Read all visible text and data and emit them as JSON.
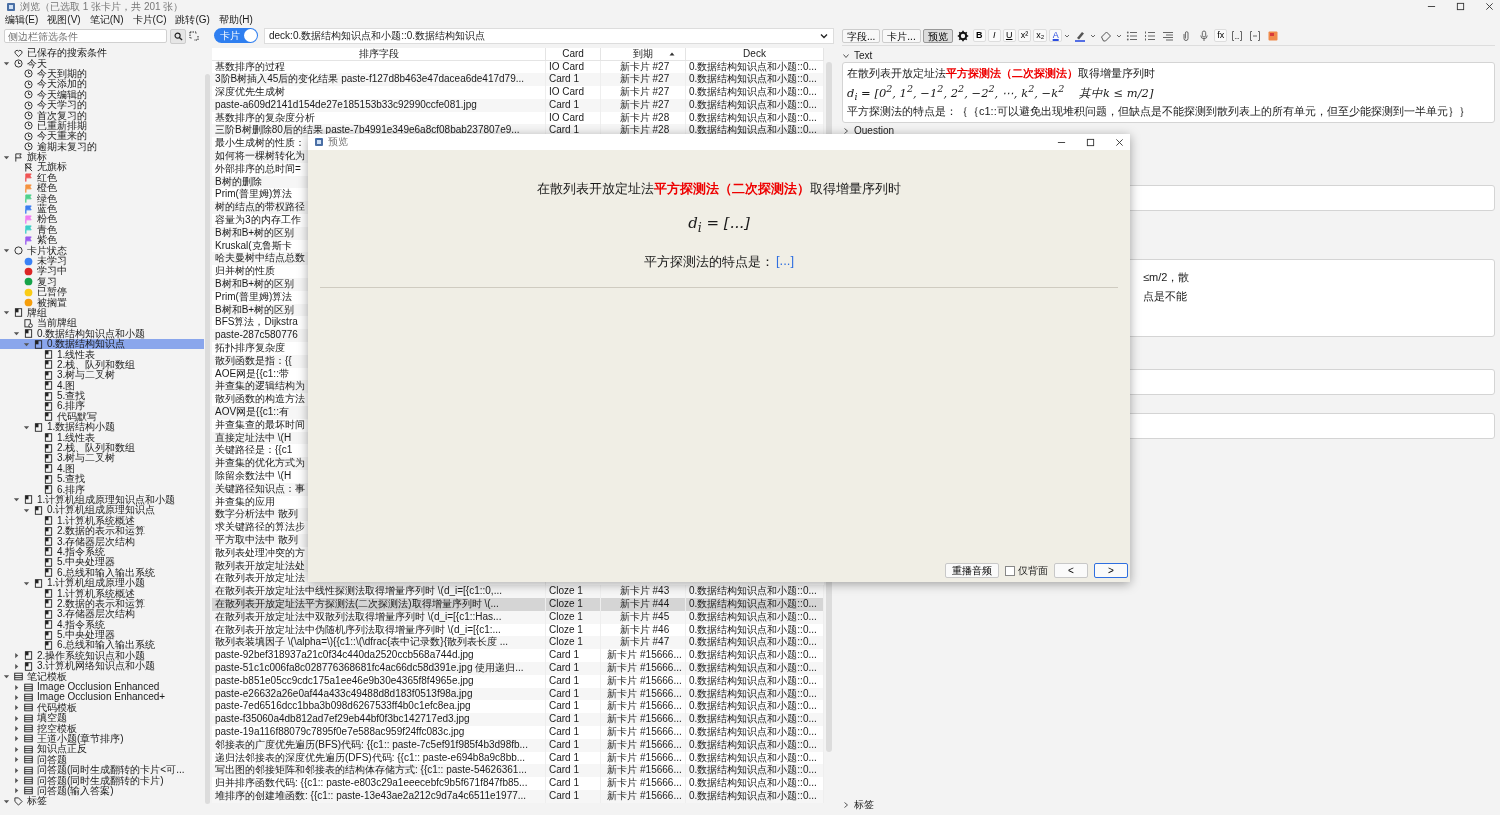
{
  "window": {
    "title": "浏览（已选取 1 张卡片，共 201 张）"
  },
  "menu": [
    "编辑(E)",
    "视图(V)",
    "笔记(N)",
    "卡片(C)",
    "跳转(G)",
    "帮助(H)"
  ],
  "sidebar": {
    "search": {
      "placeholder": "侧边栏筛选条件"
    },
    "tree": [
      {
        "label": "已保存的搜索条件",
        "kind": "heart",
        "selected": false
      },
      {
        "label": "今天",
        "kind": "clock",
        "selected": false,
        "expanded": true,
        "children": [
          {
            "label": "今天到期的",
            "kind": "clock",
            "selected": false
          },
          {
            "label": "今天添加的",
            "kind": "clock",
            "selected": false
          },
          {
            "label": "今天编辑的",
            "kind": "clock",
            "selected": false
          },
          {
            "label": "今天学习的",
            "kind": "clock",
            "selected": false
          },
          {
            "label": "首次复习的",
            "kind": "clock",
            "selected": false
          },
          {
            "label": "已重新排期",
            "kind": "clock",
            "selected": false
          },
          {
            "label": "今天重来的",
            "kind": "clock",
            "selected": false
          },
          {
            "label": "逾期未复习的",
            "kind": "clock",
            "selected": false
          }
        ]
      },
      {
        "label": "旗标",
        "kind": "flag-outline",
        "selected": false,
        "expanded": true,
        "children": [
          {
            "label": "无旗标",
            "kind": "flag-off",
            "selected": false
          },
          {
            "label": "红色",
            "kind": "flag",
            "color": "#f05454",
            "selected": false
          },
          {
            "label": "橙色",
            "kind": "flag",
            "color": "#f5923e",
            "selected": false
          },
          {
            "label": "绿色",
            "kind": "flag",
            "color": "#4fd18b",
            "selected": false
          },
          {
            "label": "蓝色",
            "kind": "flag",
            "color": "#3b7ef0",
            "selected": false
          },
          {
            "label": "粉色",
            "kind": "flag",
            "color": "#f07cf0",
            "selected": false
          },
          {
            "label": "青色",
            "kind": "flag",
            "color": "#3cd0c8",
            "selected": false
          },
          {
            "label": "紫色",
            "kind": "flag",
            "color": "#9b5cf0",
            "selected": false
          }
        ]
      },
      {
        "label": "卡片状态",
        "kind": "circle",
        "selected": false,
        "expanded": true,
        "children": [
          {
            "label": "未学习",
            "kind": "dot",
            "color": "#3b82f6",
            "selected": false
          },
          {
            "label": "学习中",
            "kind": "dot",
            "color": "#dc2626",
            "selected": false
          },
          {
            "label": "复习",
            "kind": "dot",
            "color": "#16a34a",
            "selected": false
          },
          {
            "label": "已暂停",
            "kind": "dot",
            "color": "#facc15",
            "selected": false
          },
          {
            "label": "被搁置",
            "kind": "dot",
            "color": "#f59e0b",
            "selected": false
          }
        ]
      },
      {
        "label": "牌组",
        "kind": "deck",
        "selected": false,
        "expanded": true,
        "children": [
          {
            "label": "当前牌组",
            "kind": "current-deck",
            "selected": false
          },
          {
            "label": "0.数据结构知识点和小题",
            "kind": "deck",
            "selected": false,
            "expanded": true,
            "children": [
              {
                "label": "0.数据结构知识点",
                "kind": "deck",
                "selected": true,
                "expanded": true,
                "children": [
                  {
                    "label": "1.线性表",
                    "kind": "deck",
                    "selected": false
                  },
                  {
                    "label": "2.栈、队列和数组",
                    "kind": "deck",
                    "selected": false
                  },
                  {
                    "label": "3.树与二叉树",
                    "kind": "deck",
                    "selected": false
                  },
                  {
                    "label": "4.图",
                    "kind": "deck",
                    "selected": false
                  },
                  {
                    "label": "5.查找",
                    "kind": "deck",
                    "selected": false
                  },
                  {
                    "label": "6.排序",
                    "kind": "deck",
                    "selected": false
                  },
                  {
                    "label": "代码默写",
                    "kind": "deck",
                    "selected": false
                  }
                ]
              },
              {
                "label": "1.数据结构小题",
                "kind": "deck",
                "selected": false,
                "expanded": true,
                "children": [
                  {
                    "label": "1.线性表",
                    "kind": "deck",
                    "selected": false
                  },
                  {
                    "label": "2.栈、队列和数组",
                    "kind": "deck",
                    "selected": false
                  },
                  {
                    "label": "3.树与二叉树",
                    "kind": "deck",
                    "selected": false
                  },
                  {
                    "label": "4.图",
                    "kind": "deck",
                    "selected": false
                  },
                  {
                    "label": "5.查找",
                    "kind": "deck",
                    "selected": false
                  },
                  {
                    "label": "6.排序",
                    "kind": "deck",
                    "selected": false
                  }
                ]
              }
            ]
          },
          {
            "label": "1.计算机组成原理知识点和小题",
            "kind": "deck",
            "selected": false,
            "expanded": true,
            "children": [
              {
                "label": "0.计算机组成原理知识点",
                "kind": "deck",
                "selected": false,
                "expanded": true,
                "children": [
                  {
                    "label": "1.计算机系统概述",
                    "kind": "deck",
                    "selected": false
                  },
                  {
                    "label": "2.数据的表示和运算",
                    "kind": "deck",
                    "selected": false
                  },
                  {
                    "label": "3.存储器层次结构",
                    "kind": "deck",
                    "selected": false
                  },
                  {
                    "label": "4.指令系统",
                    "kind": "deck",
                    "selected": false
                  },
                  {
                    "label": "5.中央处理器",
                    "kind": "deck",
                    "selected": false
                  },
                  {
                    "label": "6.总线和输入输出系统",
                    "kind": "deck",
                    "selected": false
                  }
                ]
              },
              {
                "label": "1.计算机组成原理小题",
                "kind": "deck",
                "selected": false,
                "expanded": true,
                "children": [
                  {
                    "label": "1.计算机系统概述",
                    "kind": "deck",
                    "selected": false
                  },
                  {
                    "label": "2.数据的表示和运算",
                    "kind": "deck",
                    "selected": false
                  },
                  {
                    "label": "3.存储器层次结构",
                    "kind": "deck",
                    "selected": false
                  },
                  {
                    "label": "4.指令系统",
                    "kind": "deck",
                    "selected": false
                  },
                  {
                    "label": "5.中央处理器",
                    "kind": "deck",
                    "selected": false
                  },
                  {
                    "label": "6.总线和输入输出系统",
                    "kind": "deck",
                    "selected": false
                  }
                ]
              }
            ]
          },
          {
            "label": "2.操作系统知识点和小题",
            "kind": "deck",
            "selected": false,
            "expanded": false
          },
          {
            "label": "3.计算机网络知识点和小题",
            "kind": "deck",
            "selected": false,
            "expanded": false
          }
        ]
      },
      {
        "label": "笔记模板",
        "kind": "notetype",
        "selected": false,
        "expanded": true,
        "children": [
          {
            "label": "Image Occlusion Enhanced",
            "kind": "notetype",
            "selected": false,
            "expanded": false
          },
          {
            "label": "Image Occlusion Enhanced+",
            "kind": "notetype",
            "selected": false,
            "expanded": false
          },
          {
            "label": "代码模板",
            "kind": "notetype",
            "selected": false,
            "expanded": false
          },
          {
            "label": "填空题",
            "kind": "notetype",
            "selected": false,
            "expanded": false
          },
          {
            "label": "挖空模板",
            "kind": "notetype",
            "selected": false,
            "expanded": false
          },
          {
            "label": "王道小题(章节排序)",
            "kind": "notetype",
            "selected": false,
            "expanded": false
          },
          {
            "label": "知识点正反",
            "kind": "notetype",
            "selected": false,
            "expanded": false
          },
          {
            "label": "问答题",
            "kind": "notetype",
            "selected": false,
            "expanded": false
          },
          {
            "label": "问答题(同时生成翻转的卡片<可...",
            "kind": "notetype",
            "selected": false,
            "expanded": false
          },
          {
            "label": "问答题(同时生成翻转的卡片)",
            "kind": "notetype",
            "selected": false,
            "expanded": false
          },
          {
            "label": "问答题(输入答案)",
            "kind": "notetype",
            "selected": false,
            "expanded": false
          }
        ]
      },
      {
        "label": "标签",
        "kind": "tag",
        "selected": false,
        "expanded": true
      }
    ]
  },
  "browser": {
    "mode_toggle": {
      "label": "卡片",
      "on": true
    },
    "search": {
      "value": "deck:0.数据结构知识点和小题::0.数据结构知识点"
    },
    "columns": [
      {
        "label": "排序字段",
        "sorted": false
      },
      {
        "label": "Card",
        "sorted": false
      },
      {
        "label": "到期",
        "sorted": true
      },
      {
        "label": "Deck",
        "sorted": false
      }
    ],
    "rows": [
      {
        "cells": [
          "基数排序的过程",
          "IO Card",
          "新卡片 #27",
          "0.数据结构知识点和小题::0..."
        ],
        "selected": false
      },
      {
        "cells": [
          "3阶B树插入45后的变化结果  paste-f127d8b463e47dacea6de417d79...",
          "Card 1",
          "新卡片 #27",
          "0.数据结构知识点和小题::0..."
        ],
        "selected": false
      },
      {
        "cells": [
          "深度优先生成树",
          "IO Card",
          "新卡片 #27",
          "0.数据结构知识点和小题::0..."
        ],
        "selected": false
      },
      {
        "cells": [
          "paste-a609d2141d154de27e185153b33c92990ccfe081.jpg",
          "Card 1",
          "新卡片 #27",
          "0.数据结构知识点和小题::0..."
        ],
        "selected": false
      },
      {
        "cells": [
          "基数排序的复杂度分析",
          "IO Card",
          "新卡片 #28",
          "0.数据结构知识点和小题::0..."
        ],
        "selected": false
      },
      {
        "cells": [
          "三阶B树删除80后的结果  paste-7b4991e349e6a8cf08bab237807e9...",
          "Card 1",
          "新卡片 #28",
          "0.数据结构知识点和小题::0..."
        ],
        "selected": false
      },
      {
        "cells": [
          "最小生成树的性质："
        ],
        "selected": false
      },
      {
        "cells": [
          "如何将一棵树转化为"
        ],
        "selected": false
      },
      {
        "cells": [
          "外部排序的总时间="
        ],
        "selected": false
      },
      {
        "cells": [
          "B树的删除"
        ],
        "selected": false
      },
      {
        "cells": [
          "Prim(普里姆)算法"
        ],
        "selected": false
      },
      {
        "cells": [
          "树的结点的带权路径"
        ],
        "selected": false
      },
      {
        "cells": [
          "容量为3的内存工作"
        ],
        "selected": false
      },
      {
        "cells": [
          "B树和B+树的区别"
        ],
        "selected": false
      },
      {
        "cells": [
          "Kruskal(克鲁斯卡"
        ],
        "selected": false
      },
      {
        "cells": [
          "哈夫曼树中结点总数"
        ],
        "selected": false
      },
      {
        "cells": [
          "归并树的性质"
        ],
        "selected": false
      },
      {
        "cells": [
          "B树和B+树的区别"
        ],
        "selected": false
      },
      {
        "cells": [
          "Prim(普里姆)算法"
        ],
        "selected": false
      },
      {
        "cells": [
          "B树和B+树的区别"
        ],
        "selected": false
      },
      {
        "cells": [
          "BFS算法，Dijkstra"
        ],
        "selected": false
      },
      {
        "cells": [
          "paste-287c580776"
        ],
        "selected": false
      },
      {
        "cells": [
          "拓扑排序复杂度"
        ],
        "selected": false
      },
      {
        "cells": [
          "散列函数是指：{{"
        ],
        "selected": false
      },
      {
        "cells": [
          "AOE网是{{c1::带"
        ],
        "selected": false
      },
      {
        "cells": [
          "并查集的逻辑结构为"
        ],
        "selected": false
      },
      {
        "cells": [
          "散列函数的构造方法"
        ],
        "selected": false
      },
      {
        "cells": [
          "AOV网是{{c1::有"
        ],
        "selected": false
      },
      {
        "cells": [
          "并查集查的最坏时间"
        ],
        "selected": false
      },
      {
        "cells": [
          "直接定址法中 \\(H"
        ],
        "selected": false
      },
      {
        "cells": [
          "关键路径是：{{c1"
        ],
        "selected": false
      },
      {
        "cells": [
          "并查集的优化方式为"
        ],
        "selected": false
      },
      {
        "cells": [
          "除留余数法中 \\(H"
        ],
        "selected": false
      },
      {
        "cells": [
          "关键路径知识点：事"
        ],
        "selected": false
      },
      {
        "cells": [
          "并查集的应用"
        ],
        "selected": false
      },
      {
        "cells": [
          "数字分析法中 散列"
        ],
        "selected": false
      },
      {
        "cells": [
          "求关键路径的算法步"
        ],
        "selected": false
      },
      {
        "cells": [
          "平方取中法中 散列"
        ],
        "selected": false
      },
      {
        "cells": [
          "散列表处理冲突的方"
        ],
        "selected": false
      },
      {
        "cells": [
          "散列表开放定址法处"
        ],
        "selected": false
      },
      {
        "cells": [
          "在散列表开放定址法"
        ],
        "selected": false
      },
      {
        "cells": [
          "在散列表开放定址法中线性探测法取得增量序列时 \\(d_i=[{c1::0,...",
          "Cloze 1",
          "新卡片 #43",
          "0.数据结构知识点和小题::0..."
        ],
        "selected": false
      },
      {
        "cells": [
          "在散列表开放定址法平方探测法(二次探测法)取得增量序列时 \\(...",
          "Cloze 1",
          "新卡片 #44",
          "0.数据结构知识点和小题::0..."
        ],
        "selected": true
      },
      {
        "cells": [
          "在散列表开放定址法中双散列法取得增量序列时 \\(d_i=[{c1::Has...",
          "Cloze 1",
          "新卡片 #45",
          "0.数据结构知识点和小题::0..."
        ],
        "selected": false
      },
      {
        "cells": [
          "在散列表开放定址法中伪随机序列法取得增量序列时 \\(d_i=[{c1:...",
          "Cloze 1",
          "新卡片 #46",
          "0.数据结构知识点和小题::0..."
        ],
        "selected": false
      },
      {
        "cells": [
          "散列表装填因子 \\(\\alpha=\\){{c1::\\(\\dfrac{表中记录数}{散列表长度 ...",
          "Cloze 1",
          "新卡片 #47",
          "0.数据结构知识点和小题::0..."
        ],
        "selected": false
      },
      {
        "cells": [
          "paste-92bef318937a21c0f34c440da2520ccb568a744d.jpg",
          "Card 1",
          "新卡片 #15666...",
          "0.数据结构知识点和小题::0..."
        ],
        "selected": false
      },
      {
        "cells": [
          "paste-51c1c006fa8c028776368681fc4ac66dc58d391e.jpg 使用递归...",
          "Card 1",
          "新卡片 #15666...",
          "0.数据结构知识点和小题::0..."
        ],
        "selected": false
      },
      {
        "cells": [
          "paste-b851e05cc9cdc175a1ee46e9b30e4365f8f4965e.jpg",
          "Card 1",
          "新卡片 #15666...",
          "0.数据结构知识点和小题::0..."
        ],
        "selected": false
      },
      {
        "cells": [
          "paste-e26632a26e0af44a433c49488d8d183f0513f98a.jpg",
          "Card 1",
          "新卡片 #15666...",
          "0.数据结构知识点和小题::0..."
        ],
        "selected": false
      },
      {
        "cells": [
          "paste-7ed6516dcc1bba3b098d6267533ff4b0c1efc8ea.jpg",
          "Card 1",
          "新卡片 #15666...",
          "0.数据结构知识点和小题::0..."
        ],
        "selected": false
      },
      {
        "cells": [
          "paste-f35060a4db812ad7ef29eb44bf0f3bc142717ed3.jpg",
          "Card 1",
          "新卡片 #15666...",
          "0.数据结构知识点和小题::0..."
        ],
        "selected": false
      },
      {
        "cells": [
          "paste-19a116f88079c7895f0e7e588ac959f24ffc083c.jpg",
          "Card 1",
          "新卡片 #15666...",
          "0.数据结构知识点和小题::0..."
        ],
        "selected": false
      },
      {
        "cells": [
          "邻接表的广度优先遍历(BFS)代码: {{c1:: paste-7c5ef91f985f4b3d98fb...",
          "Card 1",
          "新卡片 #15666...",
          "0.数据结构知识点和小题::0..."
        ],
        "selected": false
      },
      {
        "cells": [
          "递归法邻接表的深度优先遍历(DFS)代码: {{c1:: paste-e694b8a9c8bb...",
          "Card 1",
          "新卡片 #15666...",
          "0.数据结构知识点和小题::0..."
        ],
        "selected": false
      },
      {
        "cells": [
          "写出图的邻接矩阵和邻接表的结构体存储方式: {{c1:: paste-54626361...",
          "Card 1",
          "新卡片 #15666...",
          "0.数据结构知识点和小题::0..."
        ],
        "selected": false
      },
      {
        "cells": [
          "归并排序函数代码: {{c1:: paste-e803c29a1eeecebfc9b5f671f847fb85...",
          "Card 1",
          "新卡片 #15666...",
          "0.数据结构知识点和小题::0..."
        ],
        "selected": false
      },
      {
        "cells": [
          "堆排序的创建堆函数: {{c1:: paste-13e43ae2a212c9d7a4c6511e1977...",
          "Card 1",
          "新卡片 #15666...",
          "0.数据结构知识点和小题::0..."
        ],
        "selected": false
      }
    ]
  },
  "editor": {
    "buttons": [
      {
        "label": "字段...",
        "pressed": false
      },
      {
        "label": "卡片...",
        "pressed": false
      },
      {
        "label": "预览",
        "pressed": true
      }
    ],
    "tools": [
      {
        "kind": "gear"
      },
      {
        "kind": "bold",
        "label": "B"
      },
      {
        "kind": "italic",
        "label": "I"
      },
      {
        "kind": "underline",
        "label": "U"
      },
      {
        "kind": "superscript",
        "label": "x²"
      },
      {
        "kind": "subscript",
        "label": "x₂"
      },
      {
        "kind": "text-color",
        "label": "A"
      },
      {
        "kind": "highlight"
      },
      {
        "kind": "eraser"
      },
      {
        "kind": "bullet-list"
      },
      {
        "kind": "numbered-list"
      },
      {
        "kind": "align"
      },
      {
        "kind": "attach"
      },
      {
        "kind": "mic"
      },
      {
        "kind": "formula",
        "label": "fx"
      },
      {
        "kind": "cloze"
      },
      {
        "kind": "cloze-alt"
      },
      {
        "kind": "occlusion"
      }
    ],
    "text_field": {
      "label": "Text",
      "expanded": true,
      "heading": {
        "before": "在散列表开放定址法",
        "highlight": "平方探测法（二次探测法）",
        "after": "取得增量序列时"
      },
      "formula": "d$_{i}$ = [0$^{2}$, 1$^{2}$, −1$^{2}$, 2$^{2}$, −2$^{2}$, ⋯, k$^{2}$, −k$^{2}$    其中k ≤ m/2]",
      "line": "平方探测法的特点是：｛｛c1::可以避免出现堆积问题，但缺点是不能探测到散列表上的所有单元，但至少能探测到一半单元｝｝"
    },
    "question_label": {
      "label": "Question",
      "expanded": false
    },
    "covered_fields": [
      {
        "kind": "empty"
      },
      {
        "kind": "text",
        "lines": [
          "≤m/2，散",
          "点是不能"
        ]
      },
      {
        "kind": "empty"
      },
      {
        "kind": "empty"
      }
    ],
    "tags_label": {
      "label": "标签",
      "expanded": false
    }
  },
  "preview": {
    "title": "预览",
    "heading": {
      "before": "在散列表开放定址法",
      "highlight": "平方探测法（二次探测法）",
      "after": "取得增量序列时"
    },
    "formula": "d$_{i}$ = [...]",
    "question": {
      "text": "平方探测法的特点是：",
      "cloze": "[...]"
    },
    "controls": [
      {
        "kind": "button",
        "label": "重播音频",
        "focused": false
      },
      {
        "kind": "checkbox",
        "label": "仅背面",
        "checked": false
      },
      {
        "kind": "button",
        "label": "<",
        "focused": false
      },
      {
        "kind": "button",
        "label": ">",
        "focused": true
      }
    ]
  }
}
